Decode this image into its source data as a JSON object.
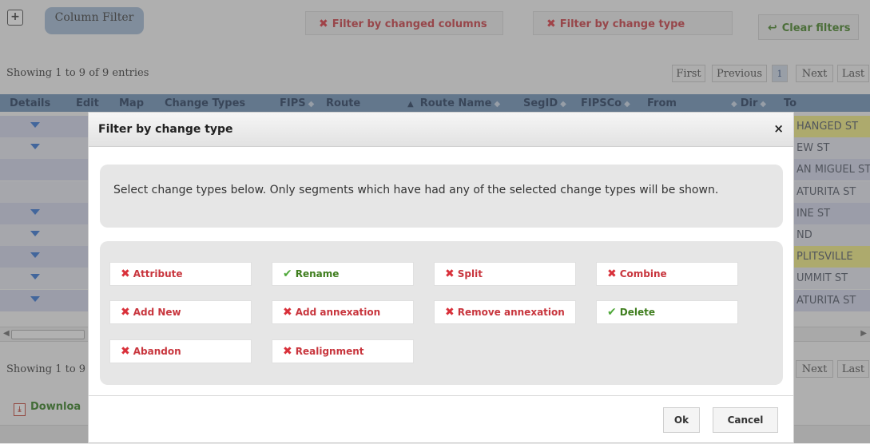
{
  "toolbar": {
    "plus": "+",
    "column_filter": "Column Filter",
    "filter_changed_columns": "Filter by changed columns",
    "filter_change_type": "Filter by change type",
    "clear_filters": "Clear filters"
  },
  "info_top": "Showing 1 to 9 of 9 entries",
  "info_bottom": "Showing 1 to 9",
  "pager_top": {
    "first": "First",
    "previous": "Previous",
    "current": "1",
    "next": "Next",
    "last": "Last"
  },
  "pager_bottom": {
    "next": "Next",
    "last": "Last"
  },
  "columns": [
    "Details",
    "Edit",
    "Map",
    "Change Types",
    "FIPS",
    "Route",
    "Route Name",
    "SegID",
    "FIPSCo",
    "From",
    "Dir",
    "To"
  ],
  "rows": [
    {
      "to": "HANGED ST",
      "highlight": true,
      "arrow": true
    },
    {
      "to": "EW ST",
      "highlight": false,
      "arrow": true
    },
    {
      "to": "AN MIGUEL ST",
      "highlight": false,
      "arrow": false
    },
    {
      "to": "ATURITA ST",
      "highlight": false,
      "arrow": false
    },
    {
      "to": "INE ST",
      "highlight": false,
      "arrow": true
    },
    {
      "to": "ND",
      "highlight": false,
      "arrow": true
    },
    {
      "to": "PLITSVILLE",
      "highlight": true,
      "arrow": true
    },
    {
      "to": "UMMIT ST",
      "highlight": false,
      "arrow": true
    },
    {
      "to": "ATURITA ST",
      "highlight": false,
      "arrow": true
    }
  ],
  "download_label": "Downloa",
  "modal": {
    "title": "Filter by change type",
    "close": "×",
    "description": "Select change types below. Only segments which have had any of the selected change types will be shown.",
    "options": [
      {
        "label": "Attribute",
        "selected": false
      },
      {
        "label": "Rename",
        "selected": true
      },
      {
        "label": "Split",
        "selected": false
      },
      {
        "label": "Combine",
        "selected": false
      },
      {
        "label": "Add New",
        "selected": false
      },
      {
        "label": "Add annexation",
        "selected": false
      },
      {
        "label": "Remove annexation",
        "selected": false
      },
      {
        "label": "Delete",
        "selected": true
      },
      {
        "label": "Abandon",
        "selected": false
      },
      {
        "label": "Realignment",
        "selected": false
      }
    ],
    "ok": "Ok",
    "cancel": "Cancel"
  },
  "colors": {
    "header_blue": "#6b8fb5",
    "row_lavender": "#cfd3e9",
    "row_light": "#e4e6ee",
    "row_yellow": "#f0ec7c",
    "red_x": "#d9303a",
    "green_check": "#4fa83a"
  },
  "icons": {
    "deselected": "x-mark-icon",
    "selected": "check-mark-icon",
    "clear": "undo-arrow-icon",
    "pdf": "pdf-file-icon",
    "row_details": "expand-triangle-icon"
  }
}
